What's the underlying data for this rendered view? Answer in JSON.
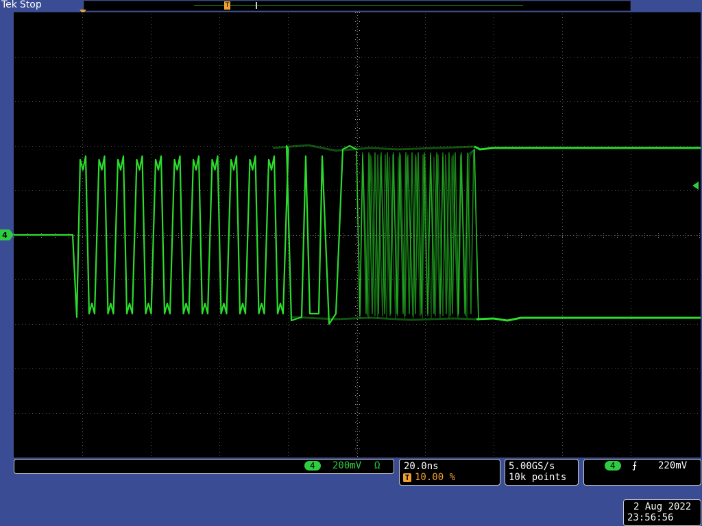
{
  "header": {
    "brand": "Tek",
    "state": "Stop"
  },
  "icons": {
    "trigger": "trigger-position-icon",
    "channel": "channel-4-marker-icon",
    "level": "trigger-level-arrow-icon",
    "slope": "rising-edge-icon"
  },
  "colors": {
    "trace": "#2ee82e",
    "trigger": "#f0a030",
    "frame": "#3a4c93",
    "badge": "#2ecc40"
  },
  "record": {
    "trigger_glyph": "T"
  },
  "channel": {
    "number": "4",
    "scale": "200mV",
    "coupling": "Ω"
  },
  "horizontal": {
    "scale": "20.0ns",
    "trigger_glyph": "T",
    "position": "10.00 %"
  },
  "acquisition": {
    "rate": "5.00GS/s",
    "points": "10k points"
  },
  "trigger": {
    "channel": "4",
    "slope_glyph": "⨍",
    "level": "220mV"
  },
  "datetime": {
    "date": "2 Aug 2022",
    "time": "23:56:56"
  }
}
